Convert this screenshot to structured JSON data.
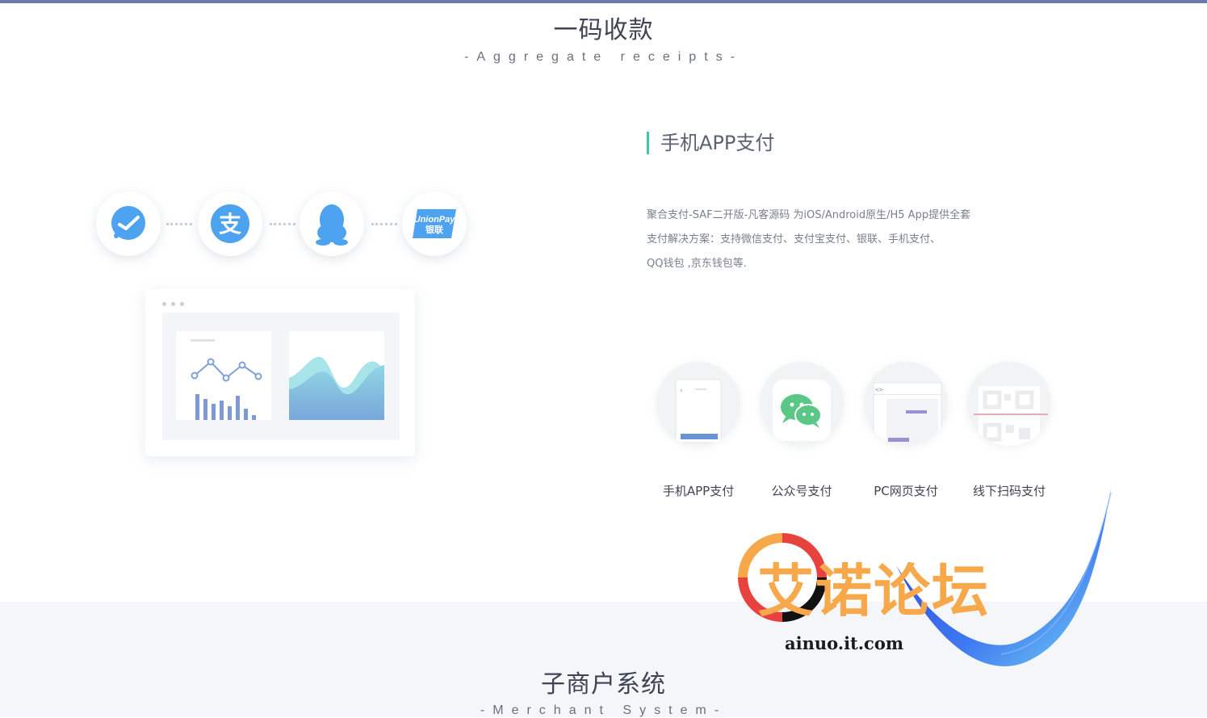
{
  "colors": {
    "top_bar": "#6d7ba8",
    "accent_green": "#3cc8a8",
    "pay_blue": "#4da3f0",
    "band_bg": "#f5f6fa",
    "watermark_orange": "#f7a84a",
    "watermark_red": "#e8423f"
  },
  "section1": {
    "title": "一码收款",
    "subtitle": "-Aggregate receipts-"
  },
  "payment_icons": [
    "wechat-pay-icon",
    "alipay-icon",
    "qq-icon",
    "unionpay-icon"
  ],
  "unionpay": {
    "line1": "UnionPay",
    "line2": "银联"
  },
  "alipay_glyph": "支",
  "feature": {
    "heading": "手机APP支付",
    "desc_line1": "聚合支付-SAF二开版-凡客源码 为iOS/Android原生/H5 App提供全套",
    "desc_line2": "支付解决方案：支持微信支付、支付宝支付、银联、手机支付、",
    "desc_line3": "QQ钱包 ,京东钱包等."
  },
  "methods": [
    {
      "label": "手机APP支付",
      "icon": "mobile-app-icon"
    },
    {
      "label": "公众号支付",
      "icon": "wechat-icon"
    },
    {
      "label": "PC网页支付",
      "icon": "pc-web-icon"
    },
    {
      "label": "线下扫码支付",
      "icon": "qr-scan-icon"
    }
  ],
  "section2": {
    "title": "子商户系统",
    "subtitle": "-Merchant System-"
  },
  "watermark": {
    "text": "艾诺论坛",
    "url": "ainuo.it.com"
  }
}
